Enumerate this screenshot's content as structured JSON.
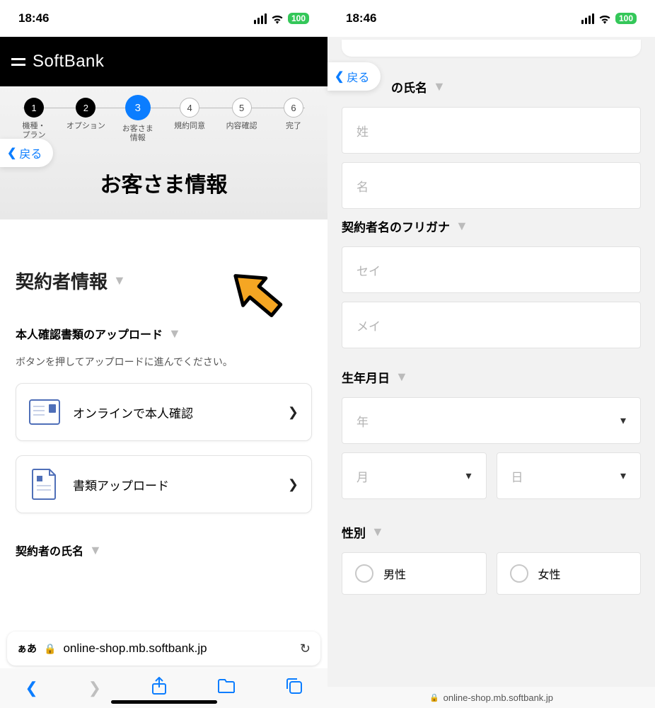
{
  "status": {
    "time": "18:46",
    "battery": "100"
  },
  "brand": "SoftBank",
  "back": "戻る",
  "steps": [
    {
      "n": "1",
      "label": "機種・\nプラン",
      "state": "done"
    },
    {
      "n": "2",
      "label": "オプション",
      "state": "done"
    },
    {
      "n": "3",
      "label": "お客さま\n情報",
      "state": "active"
    },
    {
      "n": "4",
      "label": "規約同意",
      "state": "todo"
    },
    {
      "n": "5",
      "label": "内容確認",
      "state": "todo"
    },
    {
      "n": "6",
      "label": "完了",
      "state": "todo"
    }
  ],
  "page_title": "お客さま情報",
  "left": {
    "section_title": "契約者情報",
    "upload_title": "本人確認書類のアップロード",
    "upload_desc": "ボタンを押してアップロードに進んでください。",
    "opt1": "オンラインで本人確認",
    "opt2": "書類アップロード",
    "name_title_partial": "契約者の氏名"
  },
  "url": "online-shop.mb.softbank.jp",
  "aa": "ぁあ",
  "right": {
    "name_title_partial": "の氏名",
    "last_ph": "姓",
    "first_ph": "名",
    "kana_title": "契約者名のフリガナ",
    "kana_last_ph": "セイ",
    "kana_first_ph": "メイ",
    "dob_title": "生年月日",
    "year_ph": "年",
    "month_ph": "月",
    "day_ph": "日",
    "gender_title": "性別",
    "gender_m": "男性",
    "gender_f": "女性"
  }
}
